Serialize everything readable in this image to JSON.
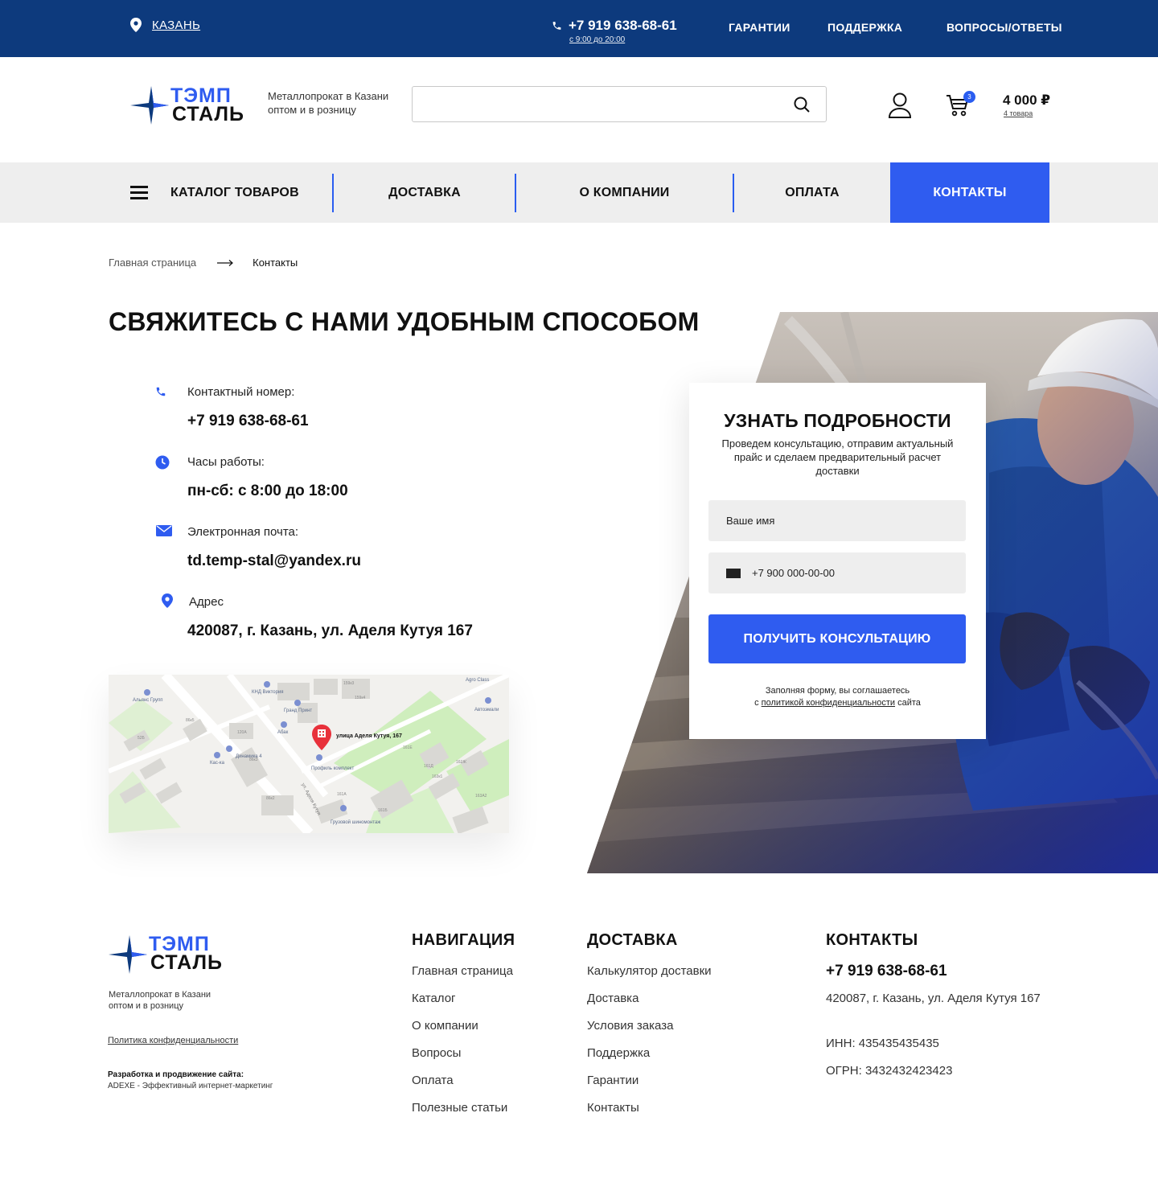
{
  "topbar": {
    "city": "КАЗАНЬ",
    "phone": "+7 919 638-68-61",
    "hours": "с 9:00 до 20:00",
    "links": [
      "ГАРАНТИИ",
      "ПОДДЕРЖКА",
      "ВОПРОСЫ/ОТВЕТЫ"
    ]
  },
  "header": {
    "logo_line1": "ТЭМП",
    "logo_line2": "СТАЛЬ",
    "tagline_line1": "Металлопрокат в Казани",
    "tagline_line2": "оптом и в розницу",
    "search_placeholder": "",
    "cart_badge": "3",
    "cart_total": "4 000 ₽",
    "cart_count": "4 товара"
  },
  "nav": {
    "catalog": "КАТАЛОГ ТОВАРОВ",
    "delivery": "ДОСТАВКА",
    "about": "О КОМПАНИИ",
    "payment": "ОПЛАТА",
    "contacts": "КОНТАКТЫ"
  },
  "breadcrumb": {
    "home": "Главная страница",
    "current": "Контакты"
  },
  "page_title": "СВЯЖИТЕСЬ С НАМИ УДОБНЫМ СПОСОБОМ",
  "contacts": [
    {
      "label": "Контактный номер:",
      "value": "+7 919 638-68-61",
      "icon": "phone-icon"
    },
    {
      "label": "Часы работы:",
      "value": "пн-сб: с 8:00 до 18:00",
      "icon": "clock-icon"
    },
    {
      "label": "Электронная почта:",
      "value": "td.temp-stal@yandex.ru",
      "icon": "mail-icon"
    },
    {
      "label": "Адрес",
      "value": "420087,  г. Казань, ул. Аделя Кутуя 167",
      "icon": "location-pin-icon"
    }
  ],
  "map": {
    "pin_label": "улица Аделя Кутуя, 167",
    "street_label": "ул. Аделя Кутуя",
    "poi": [
      "Альянс Групп",
      "КНД Виктория",
      "Гранд Принт",
      "Абак",
      "Динамика 4",
      "Кас-ка",
      "Профиль комплект",
      "Грузовой шиномонтаж",
      "Автоэмали",
      "Agro Class"
    ],
    "house_numbers": [
      "86к5",
      "120А",
      "86к3",
      "86к2",
      "52Б",
      "161Е",
      "161Д",
      "161Ж",
      "161А",
      "161Б",
      "163А2",
      "159к3",
      "159к4",
      "163к1"
    ]
  },
  "form": {
    "title": "УЗНАТЬ ПОДРОБНОСТИ",
    "subtitle": "Проведем консультацию, отправим актуальный прайс и сделаем предварительный расчет доставки",
    "name_placeholder": "Ваше имя",
    "phone_placeholder": "+7 900 000-00-00",
    "submit": "ПОЛУЧИТЬ КОНСУЛЬТАЦИЮ",
    "agree_prefix": "Заполняя форму, вы соглашаетесь",
    "agree_with": "с",
    "agree_link": "политикой конфиденциальности",
    "agree_suffix": "сайта"
  },
  "footer": {
    "tagline_line1": "Металлопрокат в Казани",
    "tagline_line2": "оптом и в розницу",
    "policy": "Политика конфиденциальности",
    "dev_title": "Разработка и продвижение сайта:",
    "dev_name": "ADEXE - Эффективный интернет-маркетинг",
    "nav_title": "НАВИГАЦИЯ",
    "nav_links": [
      "Главная страница",
      "Каталог",
      "О компании",
      "Вопросы",
      "Оплата",
      "Полезные статьи"
    ],
    "delivery_title": "ДОСТАВКА",
    "delivery_links": [
      "Калькулятор доставки",
      "Доставка",
      "Условия заказа",
      "Поддержка",
      "Гарантии",
      "Контакты"
    ],
    "contacts_title": "КОНТАКТЫ",
    "phone": "+7 919 638-68-61",
    "address": "420087,  г. Казань, ул. Аделя Кутуя 167",
    "inn": "ИНН: 435435435435",
    "ogrn": "ОГРН: 3432432423423"
  },
  "colors": {
    "topbar": "#0d3a7d",
    "accent": "#2f5cf0",
    "nav_bg": "#eeeeee"
  }
}
